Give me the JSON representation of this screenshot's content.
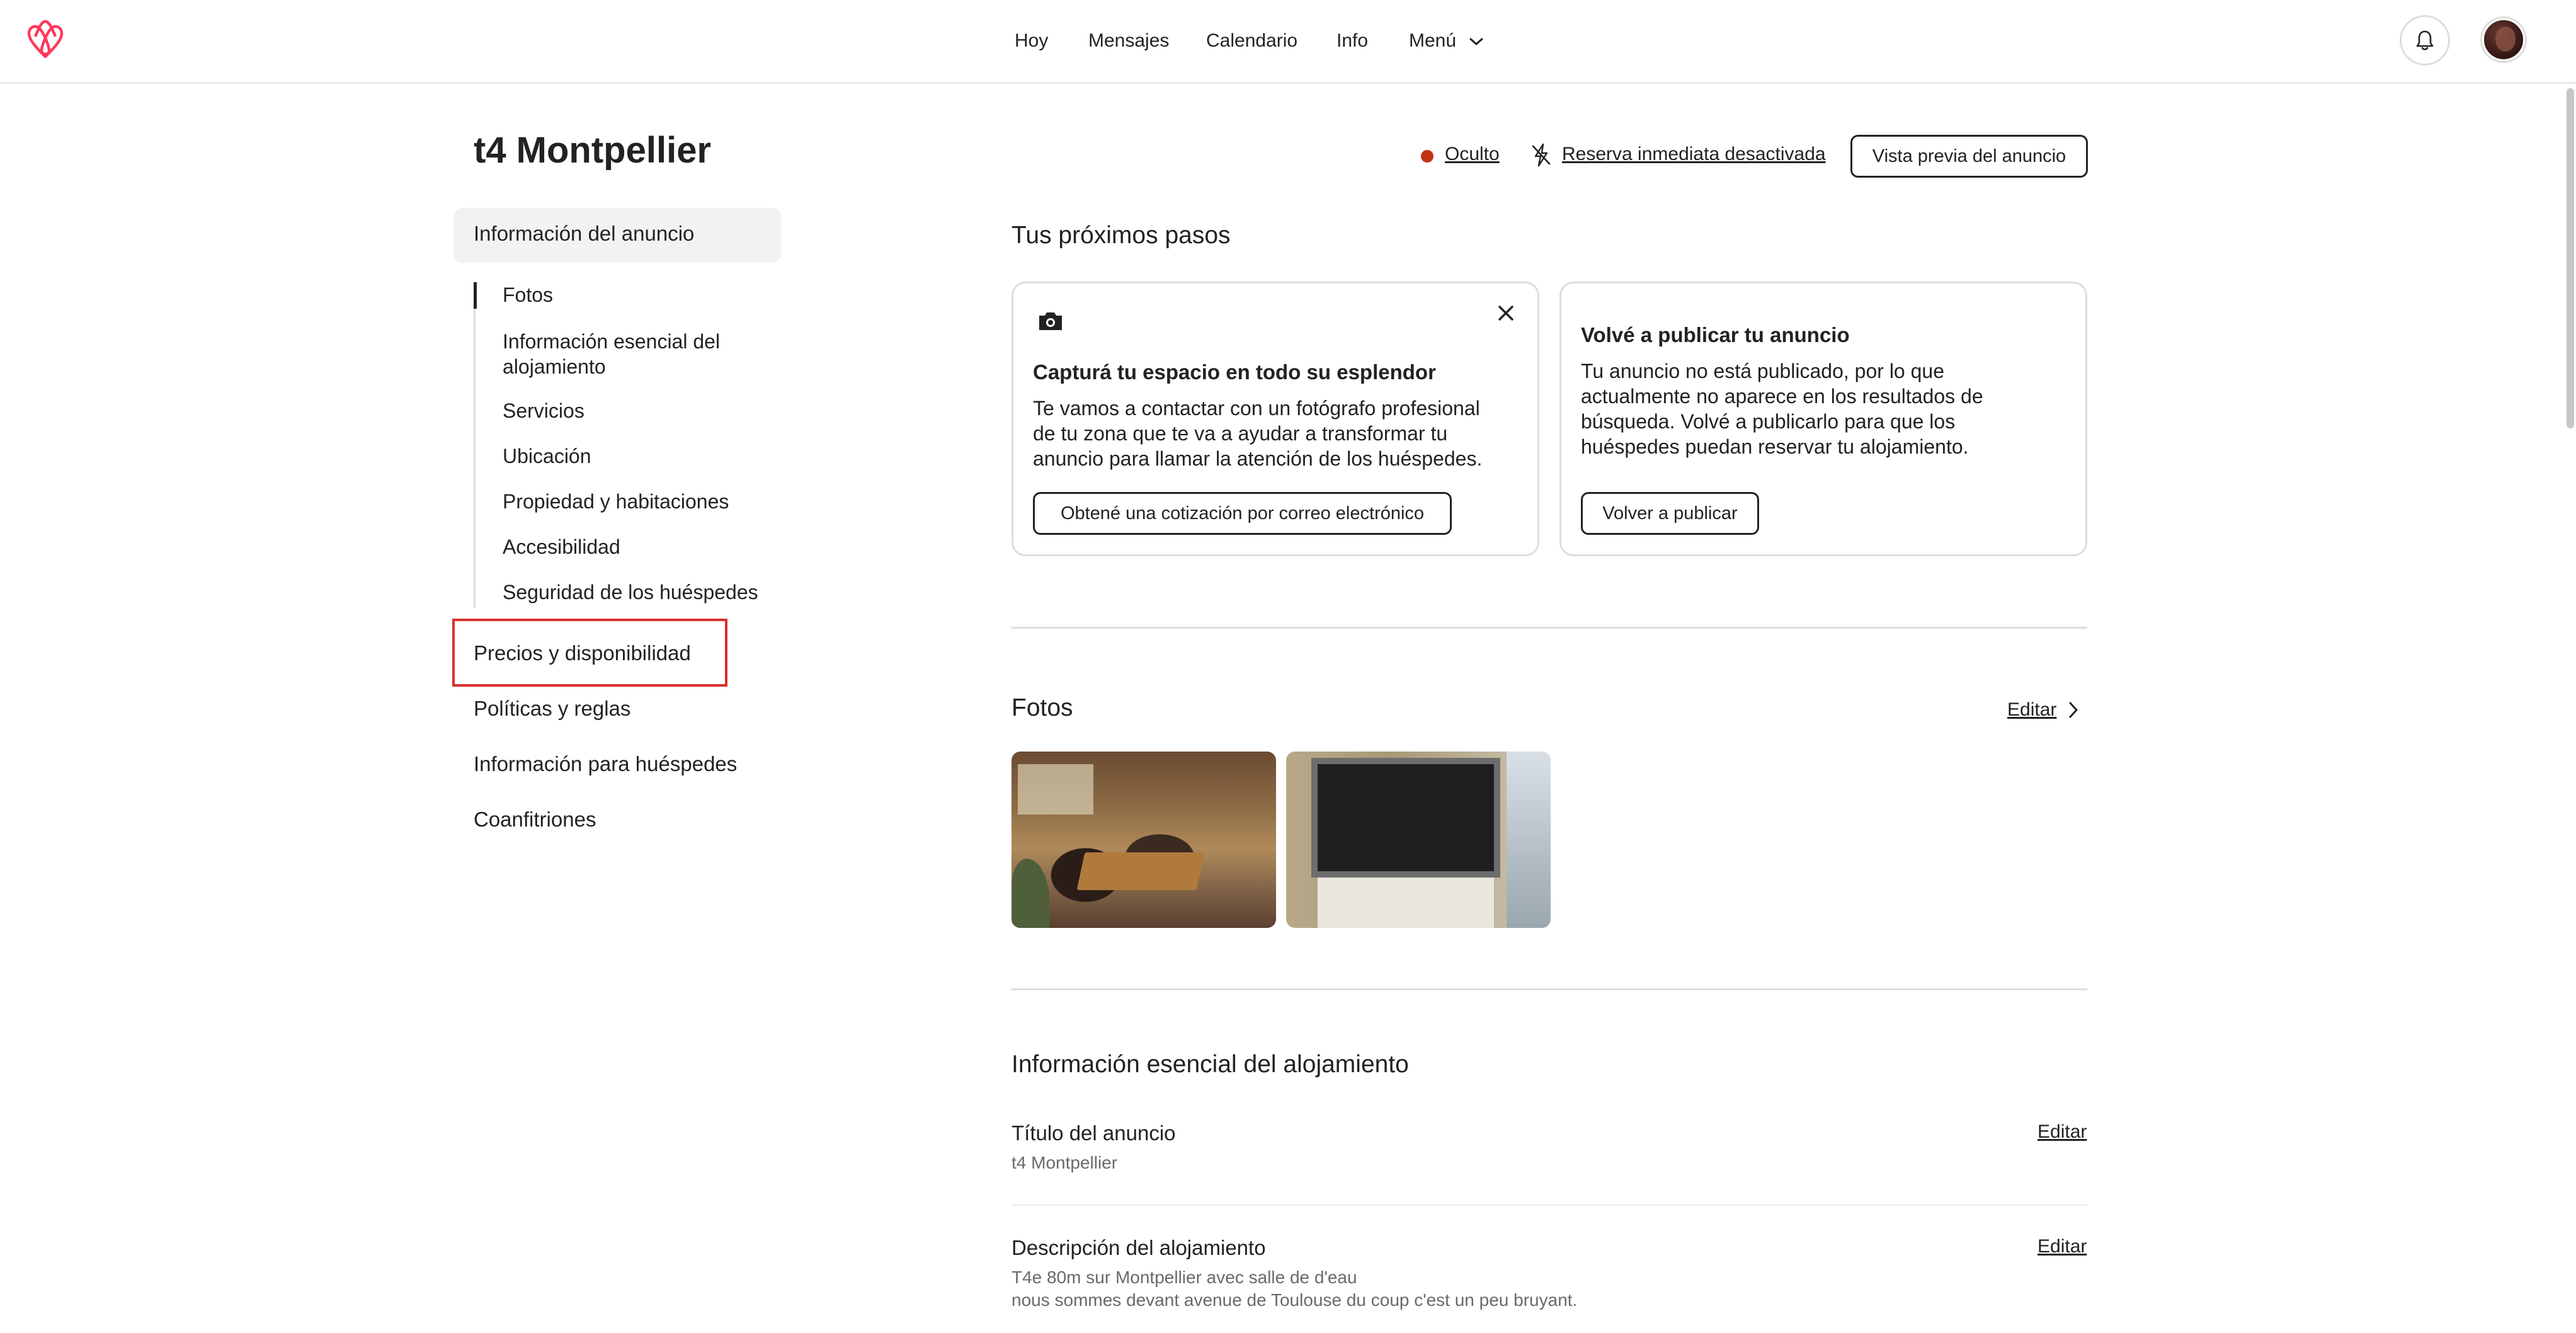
{
  "nav": {
    "items": [
      "Hoy",
      "Mensajes",
      "Calendario",
      "Info"
    ],
    "menu_label": "Menú"
  },
  "brand_color": "#FF385C",
  "icons": {
    "logo": "airbnb-logo-icon",
    "bell": "bell-icon",
    "menu_chevron": "chevron-down-icon",
    "camera": "camera-icon",
    "close": "close-icon",
    "instant": "instant-book-off-icon",
    "arrow": "chevron-right-icon"
  },
  "page": {
    "title": "t4 Montpellier"
  },
  "header_actions": {
    "status": "Oculto",
    "status_color": "#C13515",
    "instant_book": "Reserva inmediata desactivada",
    "preview_button": "Vista previa del anuncio"
  },
  "sidebar": {
    "active_section": "Información del anuncio",
    "sub_items": [
      "Fotos",
      "Información esencial del alojamiento",
      "Servicios",
      "Ubicación",
      "Propiedad y habitaciones",
      "Accesibilidad",
      "Seguridad de los huéspedes"
    ],
    "sections": [
      "Precios y disponibilidad",
      "Políticas y reglas",
      "Información para huéspedes",
      "Coanfitriones"
    ]
  },
  "next_steps": {
    "title": "Tus próximos pasos",
    "cards": [
      {
        "title": "Capturá tu espacio en todo su esplendor",
        "body_lines": [
          "Te vamos a contactar con un fotógrafo profesional",
          "de tu zona que te va a ayudar a transformar tu",
          "anuncio para llamar la atención de los huéspedes."
        ],
        "button": "Obtené una cotización por correo electrónico"
      },
      {
        "title": "Volvé a publicar tu anuncio",
        "body_lines": [
          "Tu anuncio no está publicado, por lo que",
          "actualmente no aparece en los resultados de",
          "búsqueda. Volvé a publicarlo para que los",
          "huéspedes puedan reservar tu alojamiento."
        ],
        "button": "Volver a publicar"
      }
    ]
  },
  "photos": {
    "title": "Fotos",
    "edit": "Editar"
  },
  "essential": {
    "title": "Información esencial del alojamiento",
    "fields": [
      {
        "label": "Título del anuncio",
        "value_lines": [
          "t4 Montpellier"
        ],
        "edit": "Editar"
      },
      {
        "label": "Descripción del alojamiento",
        "value_lines": [
          "T4e 80m sur Montpellier avec salle de d'eau",
          "nous sommes devant avenue de Toulouse du coup c'est un peu bruyant."
        ],
        "edit": "Editar"
      }
    ]
  }
}
